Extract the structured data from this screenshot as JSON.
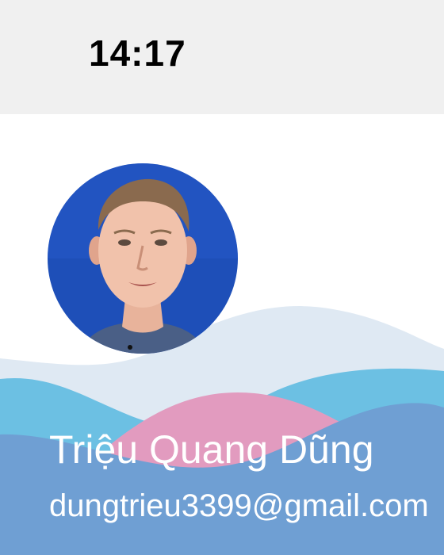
{
  "status_bar": {
    "time": "14:17"
  },
  "profile": {
    "avatar_icon": "profile-photo",
    "name": "Triệu Quang Dũng",
    "email": "dungtrieu3399@gmail.com"
  },
  "colors": {
    "status_bar_bg": "#f0f0f0",
    "wave_light": "#dfe9f3",
    "wave_cyan": "#6cc0e3",
    "wave_pink": "#e29bbf",
    "wave_blue": "#6f9fd3",
    "avatar_bg": "#1e4fb8"
  }
}
